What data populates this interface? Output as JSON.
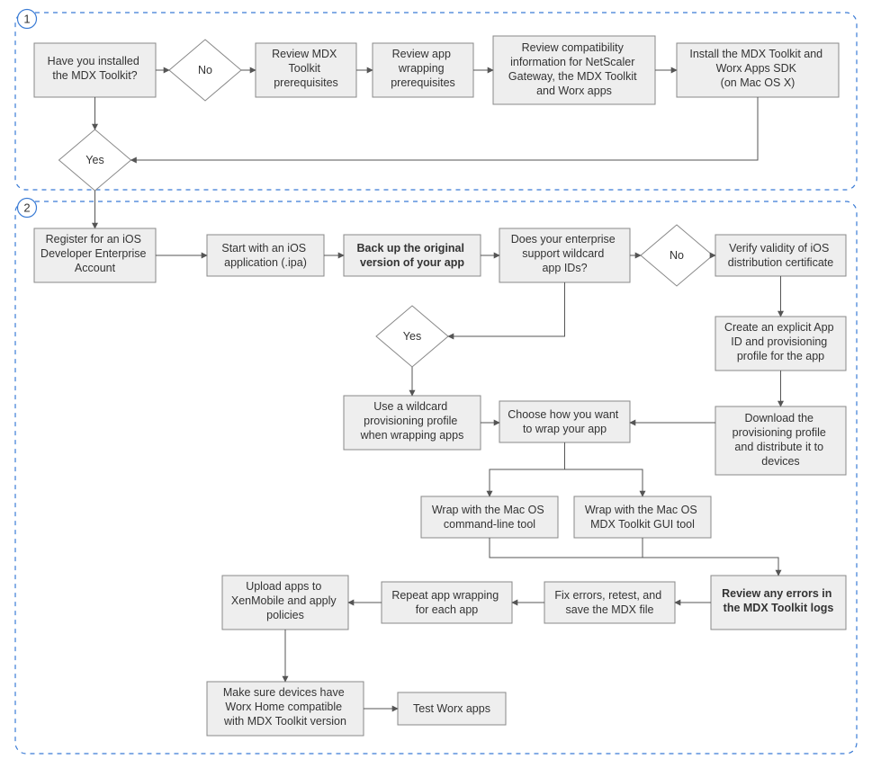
{
  "section1": {
    "number": "1",
    "q1": [
      "Have you installed",
      "the MDX Toolkit?"
    ],
    "no": "No",
    "yes": "Yes",
    "box_a": [
      "Review MDX",
      "Toolkit",
      "prerequisites"
    ],
    "box_b": [
      "Review app",
      "wrapping",
      "prerequisites"
    ],
    "box_c": [
      "Review compatibility",
      "information for NetScaler",
      "Gateway, the MDX Toolkit",
      "and Worx apps"
    ],
    "box_d": [
      "Install the MDX Toolkit and",
      "Worx Apps SDK",
      "(on Mac OS X)"
    ]
  },
  "section2": {
    "number": "2",
    "box_e": [
      "Register for an iOS",
      "Developer Enterprise",
      "Account"
    ],
    "box_f": [
      "Start with an iOS",
      "application (.ipa)"
    ],
    "box_g": [
      "Back up the original",
      "version of your app"
    ],
    "q2": [
      "Does your enterprise",
      "support wildcard",
      "app IDs?"
    ],
    "no": "No",
    "yes": "Yes",
    "box_h": [
      "Verify validity of iOS",
      "distribution certificate"
    ],
    "box_i": [
      "Create an explicit App",
      "ID and provisioning",
      "profile for the app"
    ],
    "box_j": [
      "Download the",
      "provisioning profile",
      "and distribute it to",
      "devices"
    ],
    "box_k": [
      "Use a wildcard",
      "provisioning profile",
      "when wrapping apps"
    ],
    "box_l": [
      "Choose how you want",
      "to wrap your app"
    ],
    "box_m": [
      "Wrap with the Mac OS",
      "command-line tool"
    ],
    "box_n": [
      "Wrap with the Mac OS",
      "MDX Toolkit GUI tool"
    ],
    "box_o": [
      "Review any errors in",
      "the MDX Toolkit logs"
    ],
    "box_p": [
      "Fix errors, retest, and",
      "save the MDX file"
    ],
    "box_q": [
      "Repeat app wrapping",
      "for each app"
    ],
    "box_r": [
      "Upload apps to",
      "XenMobile and apply",
      "policies"
    ],
    "box_s": [
      "Make sure devices have",
      "Worx Home compatible",
      "with MDX Toolkit version"
    ],
    "box_t": [
      "Test Worx apps"
    ]
  }
}
